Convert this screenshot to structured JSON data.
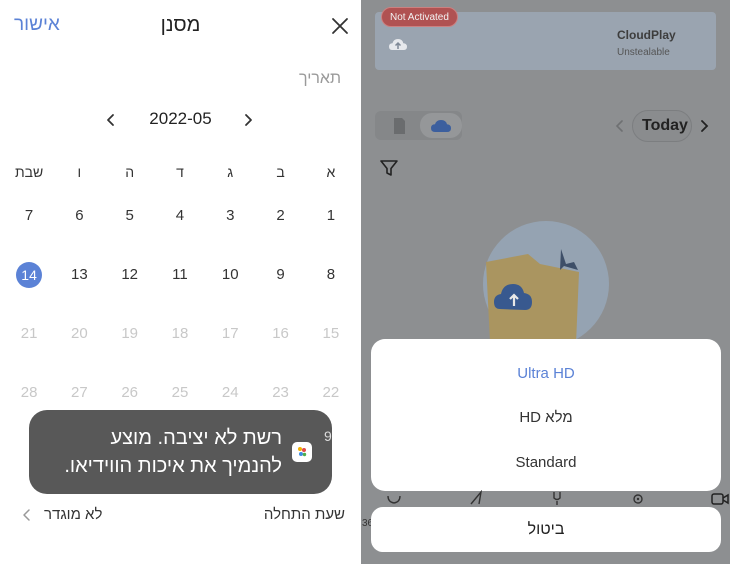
{
  "left_panel": {
    "header": {
      "confirm_label": "אישור",
      "title": "מסנן",
      "close_icon": "close-icon"
    },
    "date_label": "תאריך",
    "month": {
      "label": "2022-05"
    },
    "weekdays": [
      "א",
      "ב",
      "ג",
      "ד",
      "ה",
      "ו",
      "שבת"
    ],
    "weeks": [
      [
        "1",
        "2",
        "3",
        "4",
        "5",
        "6",
        "7"
      ],
      [
        "8",
        "9",
        "10",
        "11",
        "12",
        "13",
        "14"
      ],
      [
        "15",
        "16",
        "17",
        "18",
        "19",
        "20",
        "21"
      ],
      [
        "22",
        "23",
        "24",
        "25",
        "26",
        "27",
        "28"
      ]
    ],
    "selected_day": "14",
    "start_time_label": "שעת התחלה",
    "end_value": "לא מוגדר",
    "toast_text": "רשת לא יציבה. מוצע להנמיך את איכות הווידיאו.",
    "partial_digit": "9"
  },
  "right_panel": {
    "badge": "Not Activated",
    "cloud_card": {
      "title": "CloudPlay",
      "subtitle": "Unstealable"
    },
    "today_label": "Today",
    "quality_options": [
      "Ultra HD",
      "HD מלא",
      "Standard"
    ],
    "selected_quality": "Ultra HD",
    "cancel_label": "ביטול",
    "side_number": "36"
  },
  "colors": {
    "accent": "#5b82d6",
    "overlay": "#8d8f91",
    "toast": "#585858",
    "badge": "#b05252"
  }
}
